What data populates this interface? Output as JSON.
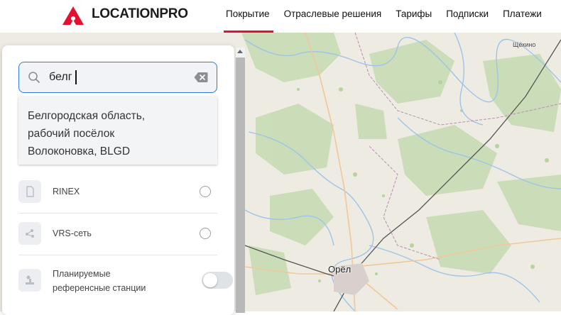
{
  "header": {
    "brand": "LOCATIONPRO",
    "nav": [
      "Покрытие",
      "Отраслевые решения",
      "Тарифы",
      "Подписки",
      "Платежи"
    ],
    "active_nav": "Покрытие"
  },
  "map": {
    "cities": {
      "orel": "Орёл",
      "shchekino": "Щёкино"
    }
  },
  "search": {
    "value": "белг",
    "suggestion_lines": [
      "Белгородская область,",
      "рабочий посёлок",
      "Волоконовка, BLGD"
    ]
  },
  "options": [
    {
      "label": "RINEX",
      "icon": "document-icon",
      "control": "radio",
      "selected": false
    },
    {
      "label": "VRS-сеть",
      "icon": "network-icon",
      "control": "radio",
      "selected": false
    },
    {
      "label_lines": [
        "Планируемые",
        "референсные станции"
      ],
      "icon": "station-icon",
      "control": "toggle",
      "on": false
    }
  ],
  "colors": {
    "accent": "#e5102f",
    "focus": "#2a7be4"
  }
}
